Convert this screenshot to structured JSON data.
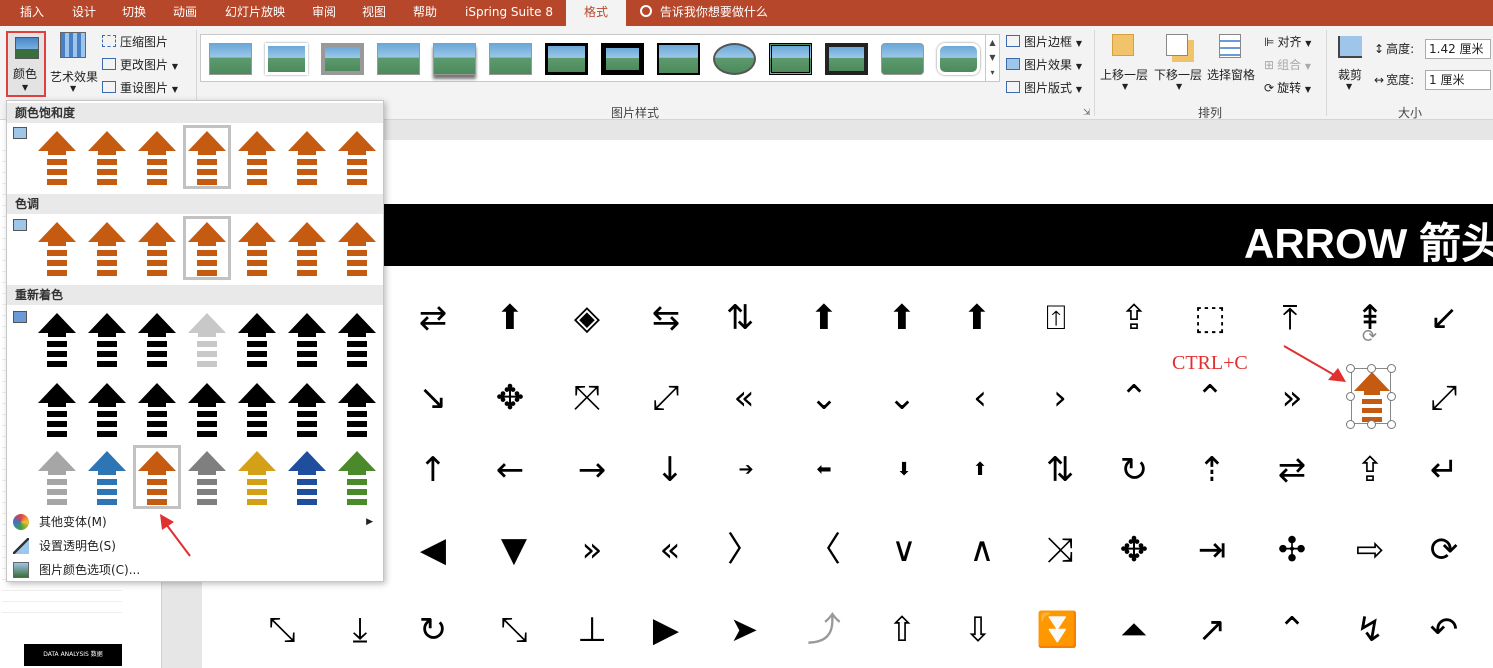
{
  "tabs": [
    {
      "label": "插入"
    },
    {
      "label": "设计"
    },
    {
      "label": "切换"
    },
    {
      "label": "动画"
    },
    {
      "label": "幻灯片放映"
    },
    {
      "label": "审阅"
    },
    {
      "label": "视图"
    },
    {
      "label": "帮助"
    },
    {
      "label": "iSpring Suite 8"
    },
    {
      "label": "格式"
    }
  ],
  "tell_me": "告诉我你想要做什么",
  "ribbon": {
    "color_label": "颜色",
    "artistic_label": "艺术效果",
    "compress": "压缩图片",
    "change": "更改图片",
    "reset": "重设图片",
    "picture_styles": "图片样式",
    "border": "图片边框",
    "effects": "图片效果",
    "layout": "图片版式",
    "bring_forward": "上移一层",
    "send_backward": "下移一层",
    "selection_pane": "选择窗格",
    "align": "对齐",
    "group": "组合",
    "rotate": "旋转",
    "arrange": "排列",
    "crop": "裁剪",
    "height_label": "高度:",
    "height_value": "1.42 厘米",
    "width_label": "宽度:",
    "width_value": "1 厘米",
    "size": "大小"
  },
  "dropdown": {
    "saturation": "颜色饱和度",
    "tone": "色调",
    "recolor": "重新着色",
    "more_variants": "其他变体(M)",
    "set_transparent": "设置透明色(S)",
    "color_options": "图片颜色选项(C)..."
  },
  "colors": {
    "accent": "#b7472a",
    "orange": "#c55a11",
    "recolor_row3": [
      "#a6a6a6",
      "#2e75b6",
      "#c55a11",
      "#7f7f7f",
      "#d4a017",
      "#1f4e9f",
      "#4a8a2a"
    ]
  },
  "slide": {
    "title": "ARROW  箭头",
    "annotation": "CTRL+C"
  },
  "left_thumb_label": "DATA ANALYSIS 数据"
}
